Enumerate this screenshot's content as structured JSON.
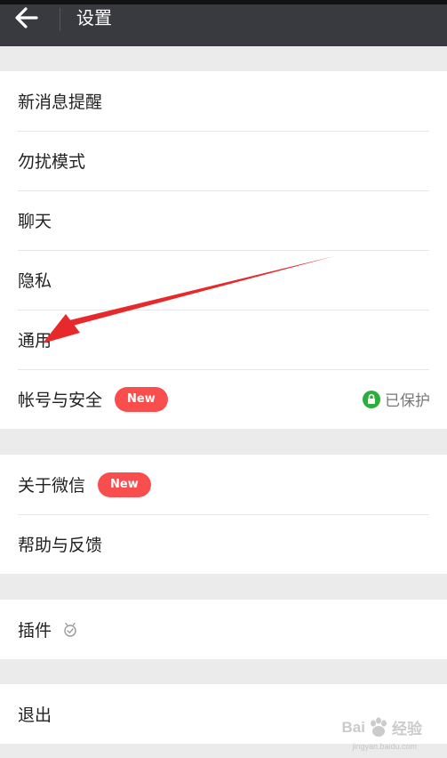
{
  "header": {
    "title": "设置"
  },
  "groups": {
    "main": {
      "items": [
        {
          "label": "新消息提醒"
        },
        {
          "label": "勿扰模式"
        },
        {
          "label": "聊天"
        },
        {
          "label": "隐私"
        },
        {
          "label": "通用"
        },
        {
          "label": "帐号与安全",
          "badge": "New",
          "status": "已保护"
        }
      ]
    },
    "about": {
      "items": [
        {
          "label": "关于微信",
          "badge": "New"
        },
        {
          "label": "帮助与反馈"
        }
      ]
    },
    "plugins": {
      "items": [
        {
          "label": "插件"
        }
      ]
    },
    "logout": {
      "items": [
        {
          "label": "退出"
        }
      ]
    }
  },
  "watermark": {
    "left": "Bai",
    "right": "经验",
    "sub": "jingyan.baidu.com"
  },
  "colors": {
    "header_bg": "#393a3f",
    "badge": "#fa4d4d",
    "secure": "#2aae3c",
    "annotation_arrow": "#e8292b"
  }
}
